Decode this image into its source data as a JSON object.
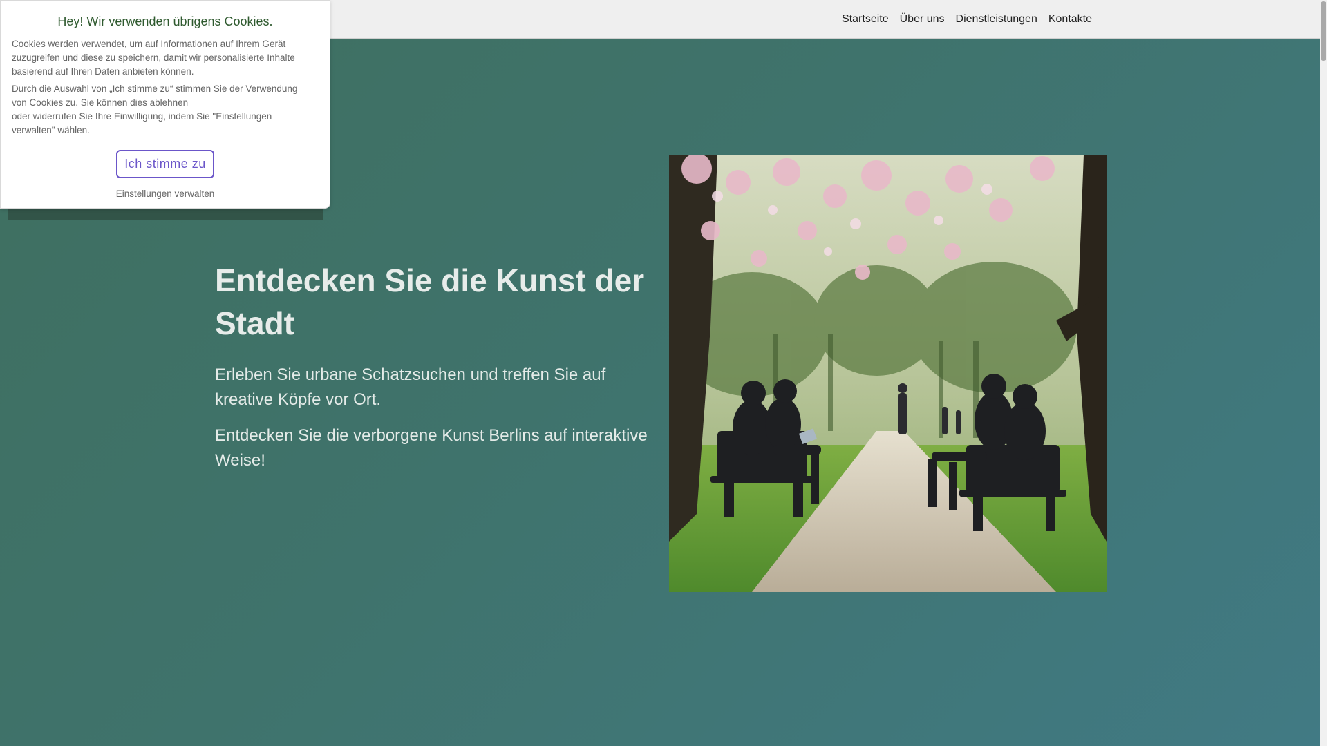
{
  "nav": {
    "items": [
      {
        "label": "Startseite"
      },
      {
        "label": "Über uns"
      },
      {
        "label": "Dienstleistungen"
      },
      {
        "label": "Kontakte"
      }
    ]
  },
  "cookie": {
    "title": "Hey! Wir verwenden übrigens Cookies.",
    "text1_lines": [
      "Cookies werden verwendet, um auf Informationen auf Ihrem Gerät",
      "zuzugreifen und diese zu speichern, damit wir personalisierte Inhalte",
      "basierend auf Ihren Daten anbieten können."
    ],
    "text2_lines": [
      "Durch die Auswahl von „Ich stimme zu“ stimmen Sie der Verwendung",
      "von Cookies zu. Sie können dies ablehnen",
      "oder widerrufen Sie Ihre Einwilligung, indem Sie \"Einstellungen",
      "verwalten\" wählen."
    ],
    "accept_label": "Ich stimme zu",
    "manage_label": "Einstellungen verwalten",
    "accent_color": "#6b56c9",
    "title_color": "#2f5a2f"
  },
  "hero": {
    "title": "Entdecken Sie die Kunst der Stadt",
    "paragraph1": "Erleben Sie urbane Schatzsuchen und treffen Sie auf kreative Köpfe vor Ort.",
    "paragraph2": "Entdecken Sie die verborgene Kunst Berlins auf interaktive Weise!",
    "image_icon": "park-photo-icon"
  },
  "colors": {
    "background": "#3f7365",
    "topbar": "#efefef"
  }
}
